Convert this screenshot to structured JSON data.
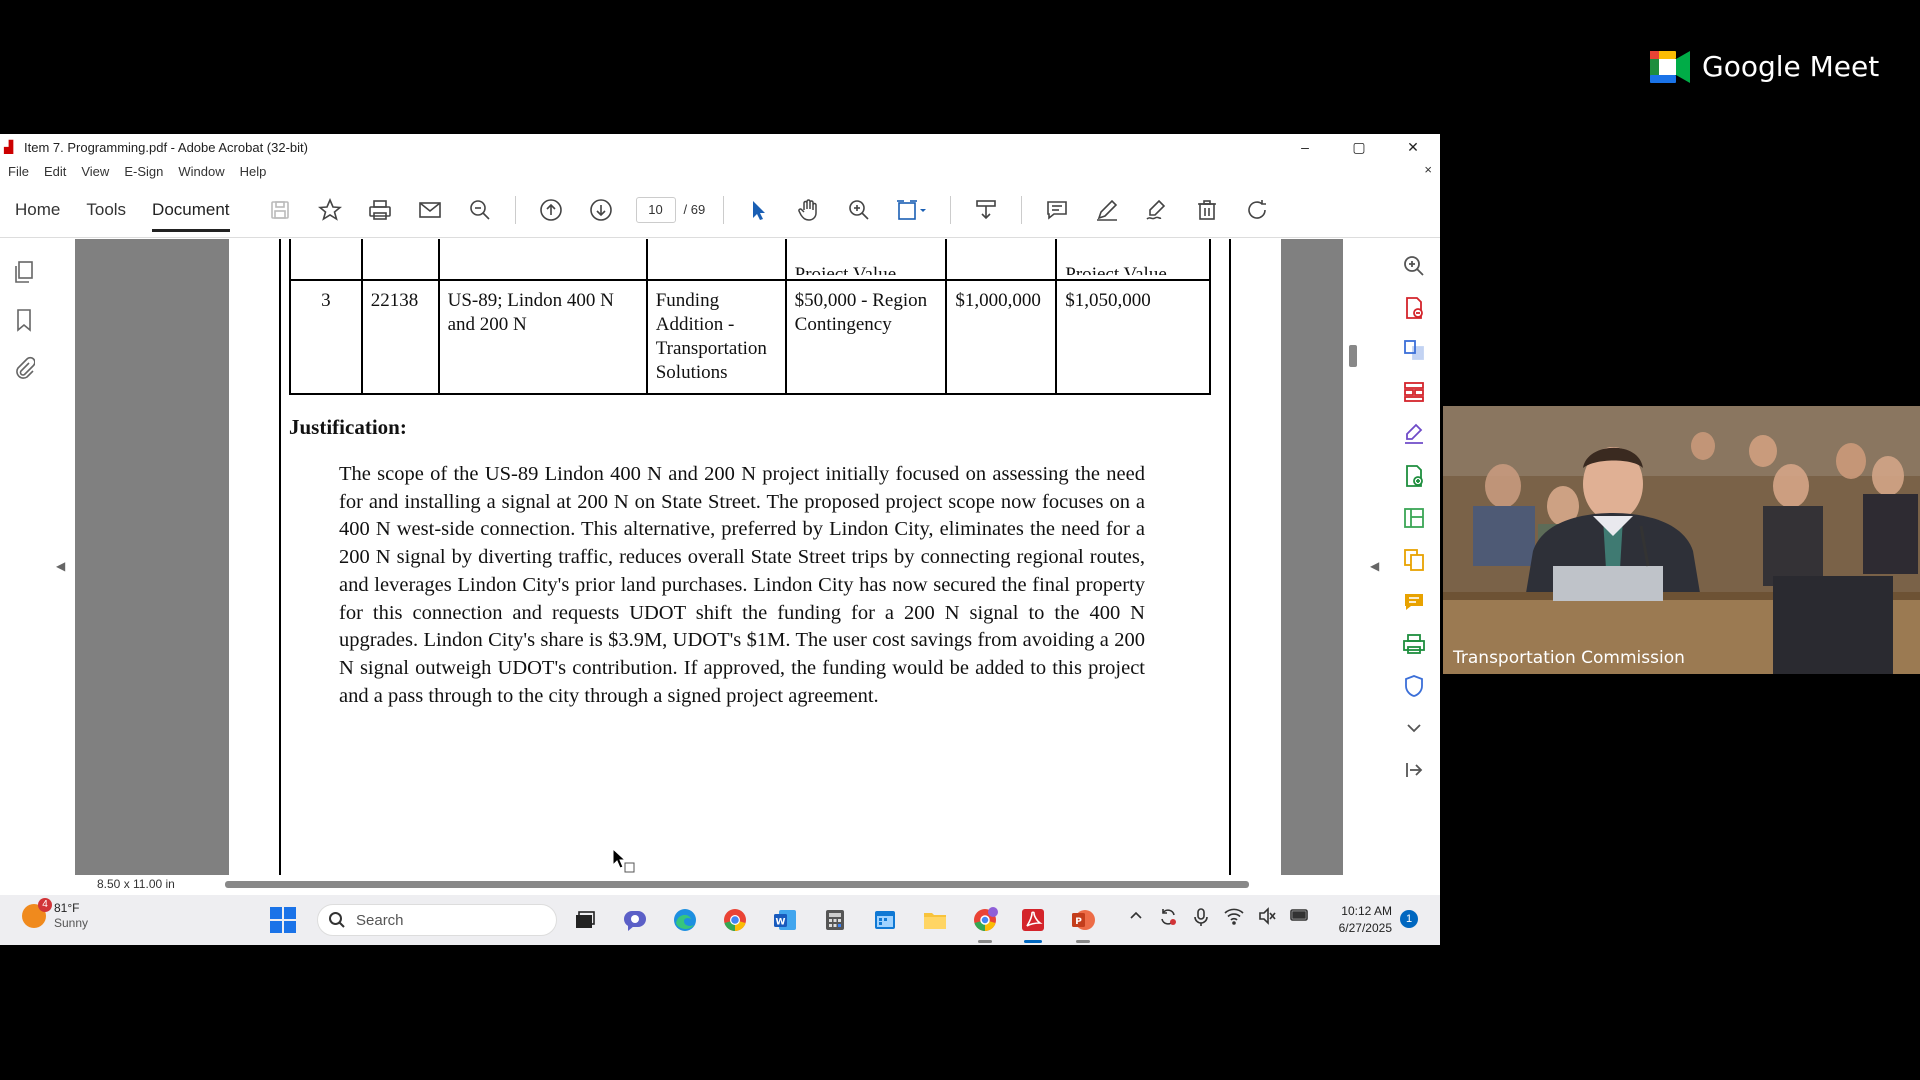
{
  "meet": {
    "brand": "Google Meet"
  },
  "window": {
    "title": "Item 7. Programming.pdf - Adobe Acrobat (32-bit)",
    "controls": [
      "–",
      "▢",
      "✕"
    ]
  },
  "menu": {
    "items": [
      "File",
      "Edit",
      "View",
      "E-Sign",
      "Window",
      "Help"
    ],
    "close_doc": "×"
  },
  "toolbar": {
    "tabs": [
      {
        "label": "Home"
      },
      {
        "label": "Tools"
      },
      {
        "label": "Document"
      }
    ],
    "page_current": "10",
    "page_total": "/  69"
  },
  "table": {
    "header_partial": [
      "",
      "",
      "",
      "",
      "Project Value",
      "",
      "Project Value"
    ],
    "row": {
      "num": "3",
      "pin": "22138",
      "name": "US-89; Lindon 400 N and 200 N",
      "type": "Funding Addition - Transportation Solutions",
      "source": "$50,000 - Region Contingency",
      "current": "$1,000,000",
      "new_value": "$1,050,000"
    }
  },
  "justification": {
    "title": "Justification:",
    "body": "The scope of the US-89 Lindon 400 N and 200 N project initially focused on assessing the need for and installing a signal at 200 N on State Street. The proposed project scope now focuses on a 400 N west-side connection. This alternative, preferred by Lindon City, eliminates the need for a 200 N signal by diverting traffic, reduces overall State Street trips by connecting regional routes, and leverages Lindon City's prior land purchases. Lindon City has now secured the final property for this connection and requests UDOT shift the funding for a 200 N signal to the 400 N upgrades. Lindon City's share is $3.9M, UDOT's $1M. The user cost savings from avoiding a 200 N signal outweigh UDOT's contribution. If approved, the funding would be added to this project and a pass through to the city through a signed project agreement."
  },
  "status": {
    "page_size": "8.50 x 11.00 in"
  },
  "taskbar": {
    "weather_badge": "4",
    "temp": "81°F",
    "condition": "Sunny",
    "search_placeholder": "Search",
    "time": "10:12 AM",
    "date": "6/27/2025",
    "notification_count": "1"
  },
  "camera": {
    "label": "Transportation Commission"
  },
  "colors": {
    "acrobat_red": "#d4242b",
    "taskbar_bg": "#eeeef1",
    "meet_green": "#00ac47"
  }
}
